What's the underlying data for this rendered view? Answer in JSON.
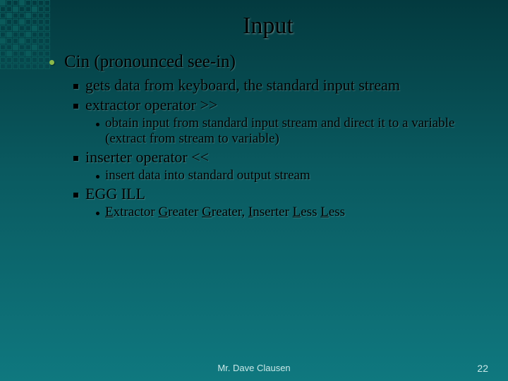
{
  "title": "Input",
  "bullets": {
    "l1": "Cin  (pronounced see-in)",
    "l2a": "gets data from keyboard, the standard input stream",
    "l2b": "extractor operator  >>",
    "l3a": "obtain input from standard input stream and direct it to a variable (extract from stream to variable)",
    "l2c": "inserter operator  <<",
    "l3b": "insert data into standard output stream",
    "l2d": "EGG ILL",
    "mnemonic": {
      "e": "E",
      "xtractor": "xtractor ",
      "g1": "G",
      "reater1": "reater ",
      "g2": "G",
      "reater2": "reater,   ",
      "i": "I",
      "nserter": "nserter ",
      "l1": "L",
      "ess1": "ess ",
      "l2": "L",
      "ess2": "ess"
    }
  },
  "footer": {
    "author": "Mr. Dave Clausen",
    "page": "22"
  }
}
